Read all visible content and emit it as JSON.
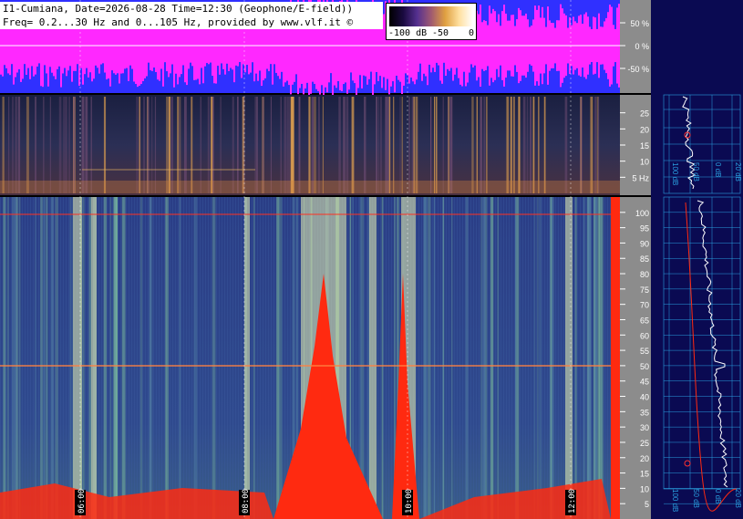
{
  "header": {
    "line1": "I1-Cumiana, Date=2026-08-28 Time=12:30 (Geophone/E-field))",
    "line2": "Freq= 0.2...30 Hz and 0...105 Hz, provided by www.vlf.it ©"
  },
  "colorbar": {
    "labels": [
      "-100 dB",
      "-50",
      "0"
    ]
  },
  "colors": {
    "waveform_bg": "#3030ff",
    "waveform_fill": "#ff28ff",
    "spectrogram_bg": "#2b3f8c",
    "burst_red": "#ff2a10",
    "right_panel_bg": "#0a0a52",
    "axis_gray": "#8c8c8c",
    "grid_cyan": "#2aa0e0"
  },
  "chart_data": [
    {
      "type": "area",
      "panel": "amplitude",
      "y_ticks": [
        "50 %",
        "0 %",
        "-50 %"
      ],
      "ylim": [
        -100,
        100
      ]
    },
    {
      "type": "heatmap",
      "panel": "low-frequency spectrogram",
      "y_ticks": [
        "25",
        "20",
        "15",
        "10",
        "5 Hz"
      ],
      "ylim": [
        0,
        30
      ]
    },
    {
      "type": "heatmap",
      "panel": "extended spectrogram",
      "y_ticks": [
        "100",
        "95",
        "90",
        "85",
        "80",
        "75",
        "70",
        "65",
        "60",
        "55",
        "50",
        "45",
        "40",
        "35",
        "30",
        "25",
        "20",
        "15",
        "10",
        "5"
      ],
      "ylim": [
        0,
        105
      ],
      "x_ticks": [
        "06:00",
        "08:00",
        "10:00",
        "12:00"
      ]
    },
    {
      "type": "line",
      "panel": "spectrum profile",
      "x_tick_labels_top": [
        "100 dB",
        "50 dB",
        "0 dB",
        "20 dB"
      ],
      "x_tick_labels_bottom": [
        "100 dB",
        "50 dB",
        "0 dB",
        "20 dB"
      ]
    }
  ]
}
